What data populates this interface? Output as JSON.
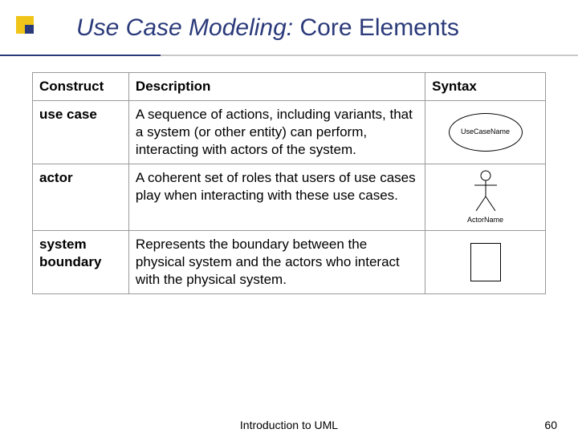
{
  "title": {
    "italic_part": "Use Case Modeling:",
    "rest": " Core Elements"
  },
  "table": {
    "headers": {
      "construct": "Construct",
      "description": "Description",
      "syntax": "Syntax"
    },
    "rows": [
      {
        "construct": "use case",
        "description": "A sequence of actions, including variants, that a system (or other entity) can perform, interacting with actors of the system.",
        "syntax_label": "UseCaseName",
        "syntax_kind": "ellipse"
      },
      {
        "construct": "actor",
        "description": "A coherent set of roles that users of use cases play when interacting with these use cases.",
        "syntax_label": "ActorName",
        "syntax_kind": "stickfigure"
      },
      {
        "construct": "system boundary",
        "description": "Represents the boundary between the physical system and the actors who interact with the physical system.",
        "syntax_label": "",
        "syntax_kind": "rect"
      }
    ]
  },
  "footer": {
    "center": "Introduction to UML",
    "page": "60"
  }
}
